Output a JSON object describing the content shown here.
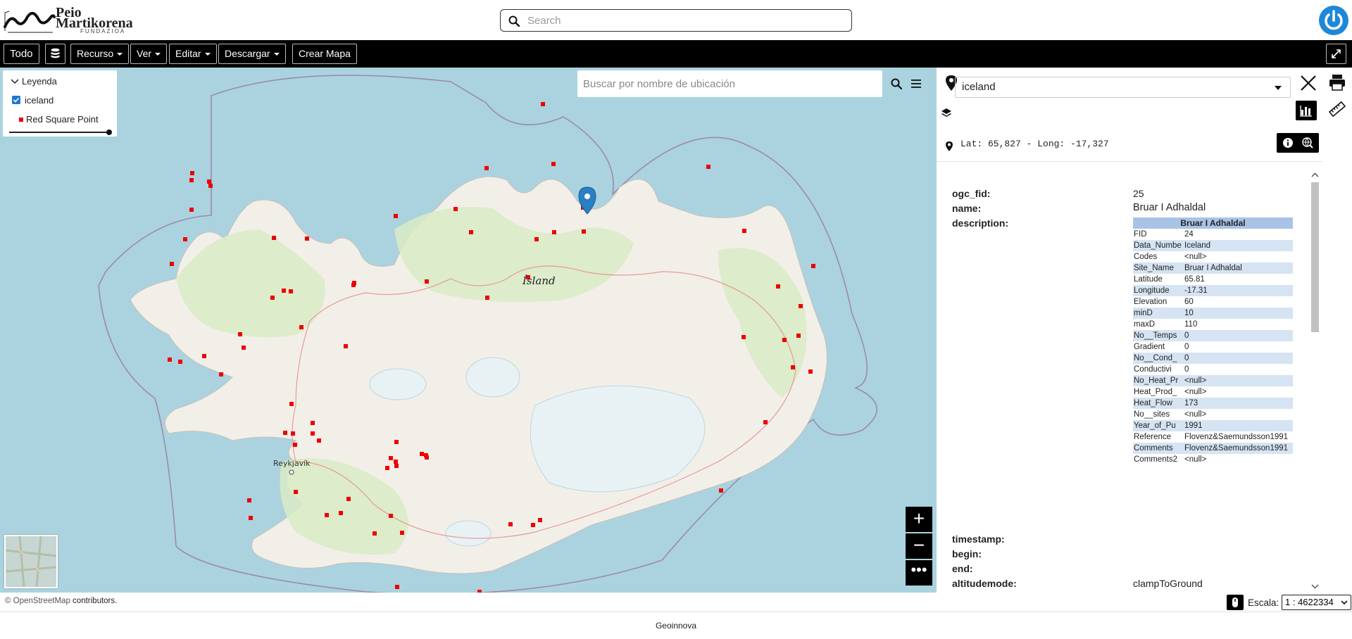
{
  "header": {
    "logo_line1": "Peio",
    "logo_line2": "Martikorena",
    "logo_line3": "FUNDAZIOA",
    "search_placeholder": "Search"
  },
  "toolbar": {
    "todo": "Todo",
    "recurso": "Recurso",
    "ver": "Ver",
    "editar": "Editar",
    "descargar": "Descargar",
    "crear_mapa": "Crear Mapa"
  },
  "legend": {
    "title": "Leyenda",
    "layer": "iceland",
    "symbol_label": "Red Square Point",
    "symbol_color": "#ee0000",
    "opacity": 1.0
  },
  "map": {
    "search_placeholder": "Buscar por nombre de ubicación",
    "country_label": "Ísland",
    "city_label": "Reykjavík",
    "sea_color": "#aad3df",
    "land_color": "#f2efe9"
  },
  "panel": {
    "layer_select": "iceland",
    "coords": "Lat: 65,827 - Long: -17,327",
    "attributes": [
      {
        "key": "ogc_fid:",
        "value": "25"
      },
      {
        "key": "name:",
        "value": "Bruar I Adhaldal"
      },
      {
        "key": "description:",
        "value": ""
      },
      {
        "key": "timestamp:",
        "value": ""
      },
      {
        "key": "begin:",
        "value": ""
      },
      {
        "key": "end:",
        "value": ""
      },
      {
        "key": "altitudemode:",
        "value": "clampToGround"
      }
    ],
    "description_title": "Bruar I Adhaldal",
    "description_rows": [
      {
        "k": "FID",
        "v": "24"
      },
      {
        "k": "Data_Numbe",
        "v": "Iceland"
      },
      {
        "k": "Codes",
        "v": "<null>"
      },
      {
        "k": "Site_Name",
        "v": "Bruar I Adhaldal"
      },
      {
        "k": "Latitude",
        "v": "65.81"
      },
      {
        "k": "Longitude",
        "v": "-17.31"
      },
      {
        "k": "Elevation",
        "v": "60"
      },
      {
        "k": "minD",
        "v": "10"
      },
      {
        "k": "maxD",
        "v": "110"
      },
      {
        "k": "No__Temps",
        "v": "0"
      },
      {
        "k": "Gradient",
        "v": "0"
      },
      {
        "k": "No__Cond_",
        "v": "0"
      },
      {
        "k": "Conductivi",
        "v": "0"
      },
      {
        "k": "No_Heat_Pr",
        "v": "<null>"
      },
      {
        "k": "Heat_Prod_",
        "v": "<null>"
      },
      {
        "k": "Heat_Flow",
        "v": "173"
      },
      {
        "k": "No__sites",
        "v": "<null>"
      },
      {
        "k": "Year_of_Pu",
        "v": "1991"
      },
      {
        "k": "Reference",
        "v": "Flovenz&Saemundsson1991"
      },
      {
        "k": "Comments",
        "v": "Flovenz&Saemundsson1991"
      },
      {
        "k": "Comments2",
        "v": "<null>"
      }
    ]
  },
  "bottom": {
    "credit_link": "© OpenStreetMap",
    "credit_text": " contributors.",
    "scale_label": "Escala:",
    "scale_value": "1 : 4622334"
  },
  "footer": {
    "text": "Geoinnova"
  },
  "colors": {
    "accent": "#1e88d8",
    "marker": "#2a7fc5",
    "table_header": "#a9c3e6",
    "table_alt": "#d6e3f2"
  }
}
